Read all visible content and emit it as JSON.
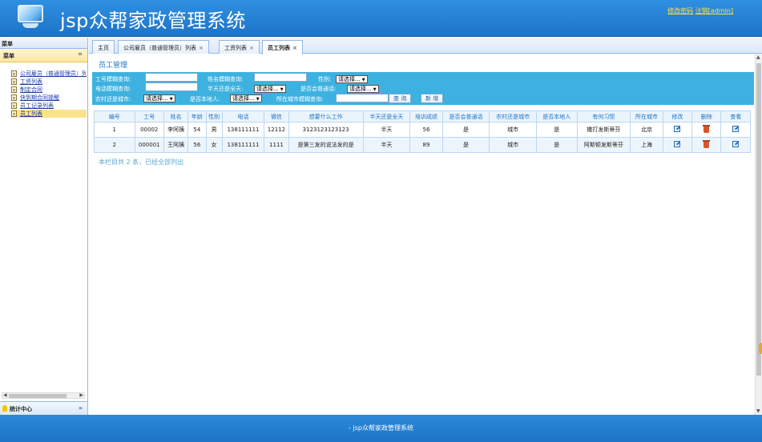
{
  "header": {
    "title": "jsp众帮家政管理系统",
    "links": [
      "修改密码",
      "注销[admin]"
    ]
  },
  "sidebar": {
    "head": "菜单",
    "panel_title": "菜单",
    "items": [
      {
        "label": "公司雇员（普通管理员）列表"
      },
      {
        "label": "工资列表"
      },
      {
        "label": "制定合同"
      },
      {
        "label": "快到期合同提醒"
      },
      {
        "label": "员工记录列表"
      },
      {
        "label": "员工列表"
      }
    ],
    "active_index": 5,
    "stat_label": "统计中心"
  },
  "tabs": [
    {
      "label": "主页",
      "closable": false
    },
    {
      "label": "公司雇员（普通管理员）列表",
      "closable": true
    },
    {
      "label": "工资列表",
      "closable": true
    },
    {
      "label": "员工列表",
      "closable": true
    }
  ],
  "main": {
    "section_title": "员工管理",
    "search": {
      "id_label": "工号模糊查询:",
      "name_label": "姓名模糊查询:",
      "gender_label": "性别:",
      "phone_label": "电话模糊查询:",
      "halfday_label": "半天还是全天:",
      "contract_label": "是否会普通话:",
      "rural_label": "农村还是城市:",
      "local_label": "是否本地人:",
      "city_label": "所在城市模糊查询:",
      "select_placeholder": "请选择...",
      "query_button": "查 询",
      "add_button": "新 增"
    },
    "table": {
      "headers": [
        "编号",
        "工号",
        "姓名",
        "年龄",
        "性别",
        "电话",
        "微信",
        "想要什么工作",
        "半天还是全天",
        "培训成绩",
        "是否会普通话",
        "农村还是城市",
        "是否本地人",
        "有何习惯",
        "所在城市",
        "修改",
        "删除",
        "查看"
      ],
      "rows": [
        [
          "1",
          "00002",
          "李阿姨",
          "54",
          "男",
          "138111111",
          "12112",
          "3123123123123",
          "半天",
          "56",
          "是",
          "城市",
          "是",
          "撒打发斯蒂芬",
          "北京"
        ],
        [
          "2",
          "000001",
          "王阿姨",
          "56",
          "女",
          "138111111",
          "1111",
          "是第三发的说法发的是",
          "半天",
          "89",
          "是",
          "城市",
          "是",
          "阿斯顿发斯蒂芬",
          "上海"
        ]
      ]
    },
    "summary": "本栏目共 2 条，已经全部列出"
  },
  "footer": {
    "text": "- jsp众帮家政管理系统"
  },
  "icons": {
    "edit": "edit-icon",
    "delete": "trash-icon",
    "view": "view-icon"
  }
}
